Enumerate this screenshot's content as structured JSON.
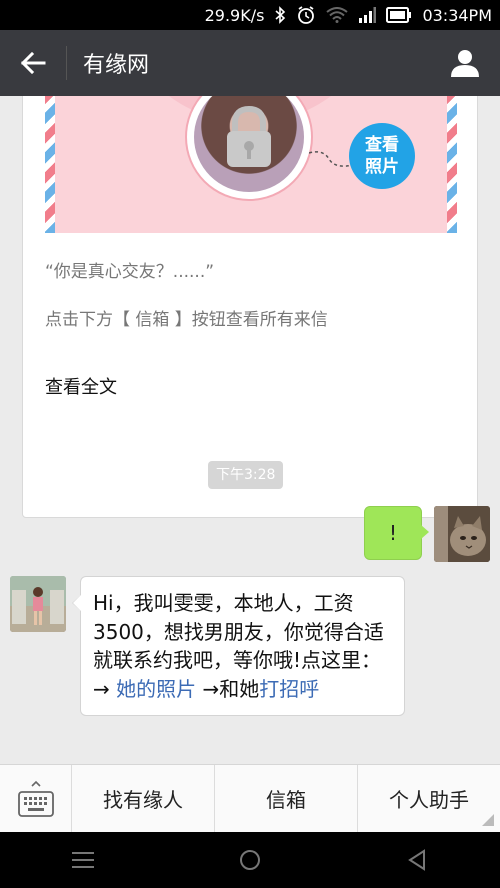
{
  "status_bar": {
    "speed": "29.9K/s",
    "time": "03:34PM"
  },
  "header": {
    "title": "有缘网"
  },
  "article_card": {
    "view_photo_line1": "查看",
    "view_photo_line2": "照片",
    "quote": "“你是真心交友？......”",
    "description": "点击下方【 信箱 】按钮查看所有来信",
    "read_all": "查看全文"
  },
  "chat": {
    "time_label": "下午3:28",
    "my_message": "!",
    "her_message": {
      "text_before_links": "Hi，我叫雯雯，本地人，工资3500，想找男朋友，你觉得合适就联系约我吧，等你哦!点这里：→ ",
      "link1": "她的照片",
      "middle_text": " →和她",
      "link2": "打招呼"
    }
  },
  "bottom_menu": {
    "items": [
      "找有缘人",
      "信箱",
      "个人助手"
    ]
  },
  "colors": {
    "title_bar": "#393a3f",
    "my_bubble": "#9fe658",
    "link": "#3c6bb5",
    "photo_badge": "#22a3e6"
  }
}
